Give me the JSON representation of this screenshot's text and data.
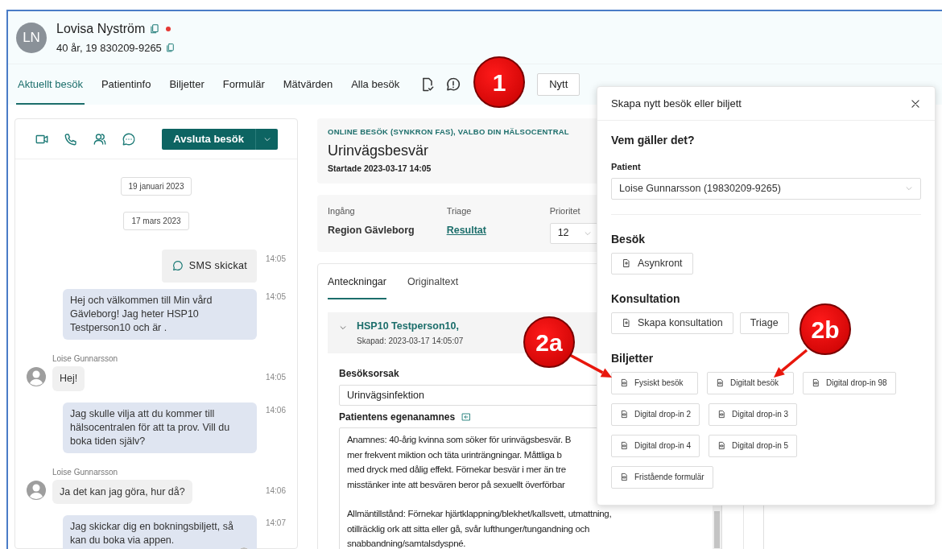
{
  "patient": {
    "initials": "LN",
    "name": "Lovisa Nyström",
    "alert": true,
    "details": "40 år, 19 830209-9265"
  },
  "tabs": [
    {
      "label": "Aktuellt besök",
      "selected": true
    },
    {
      "label": "Patientinfo",
      "selected": false
    },
    {
      "label": "Biljetter",
      "selected": false
    },
    {
      "label": "Formulär",
      "selected": false
    },
    {
      "label": "Mätvärden",
      "selected": false
    },
    {
      "label": "Alla besök",
      "selected": false
    }
  ],
  "new_button": "Nytt",
  "chat": {
    "end_button": "Avsluta besök",
    "items": [
      {
        "kind": "date",
        "text": "19 januari 2023"
      },
      {
        "kind": "date",
        "text": "17 mars 2023"
      },
      {
        "kind": "system",
        "text": "SMS skickat",
        "time": "14:05"
      },
      {
        "kind": "outgoing",
        "text": "Hej och välkommen till Min vård Gävleborg! Jag heter HSP10 Testperson10 och är .",
        "time": "14:05",
        "read": false
      },
      {
        "kind": "incoming",
        "sender": "Loise Gunnarsson",
        "text": "Hej!",
        "time": "14:05"
      },
      {
        "kind": "outgoing",
        "text": "Jag skulle vilja att du kommer till hälsocentralen för att ta prov. Vill du boka tiden själv?",
        "time": "14:06",
        "read": false
      },
      {
        "kind": "incoming",
        "sender": "Loise Gunnarsson",
        "text": "Ja det kan jag göra, hur då?",
        "time": "14:06"
      },
      {
        "kind": "outgoing",
        "text": "Jag skickar dig en bokningsbiljett, så kan du boka via appen.",
        "time": "14:07",
        "read": true
      }
    ]
  },
  "visit": {
    "context": "ONLINE BESÖK (SYNKRON FAS), VALBO DIN HÄLSOCENTRAL",
    "title": "Urinvägsbesvär",
    "started": "Startade 2023-03-17 14:05"
  },
  "info_fields": [
    {
      "kind": "text",
      "label": "Ingång",
      "value": "Region Gävleborg"
    },
    {
      "kind": "link",
      "label": "Triage",
      "value": "Resultat"
    },
    {
      "kind": "select",
      "label": "Prioritet",
      "value": "12"
    }
  ],
  "notes": {
    "tabs": [
      {
        "label": "Anteckningar",
        "selected": true
      },
      {
        "label": "Originaltext",
        "selected": false
      }
    ],
    "entry": {
      "expanded": true,
      "author": "HSP10 Testperson10,",
      "created": "Skapad: 2023-03-17 14:05:07",
      "reason_label": "Besöksorsak",
      "reason": "Urinvägsinfektion",
      "anamnesis_label": "Patientens egenanamnes",
      "paragraphs": [
        [
          "Anamnes: 40-årig kvinna som söker för urinvägsbesvär. B",
          "mer frekvent miktion och täta urinträngningar. Måttliga b",
          "med dryck med dålig effekt. Förnekar besvär i mer än tre",
          "misstänker inte att besvären beror på sexuellt överförbar"
        ],
        [
          "Allmäntillstånd: Förnekar hjärtklappning/blekhet/kallsvett, utmattning,",
          "otillräcklig ork att sitta eller gå, svår lufthunger/tungandning och",
          "snabbandning/samtalsdyspné."
        ]
      ]
    }
  },
  "popover": {
    "title": "Skapa nytt besök eller biljett",
    "who_heading": "Vem gäller det?",
    "patient_label": "Patient",
    "patient_value": "Loise Gunnarsson (19830209-9265)",
    "sections": [
      {
        "heading": "Besök",
        "rows": [
          [
            {
              "label": "Asynkront",
              "icon": true
            }
          ]
        ]
      },
      {
        "heading": "Konsultation",
        "rows": [
          [
            {
              "label": "Skapa konsultation",
              "icon": true
            },
            {
              "label": "Triage",
              "icon": false
            }
          ]
        ]
      },
      {
        "heading": "Biljetter",
        "small": true,
        "rows": [
          [
            {
              "label": "Fysiskt besök",
              "icon": true
            },
            {
              "label": "Digitalt besök",
              "icon": true
            },
            {
              "label": "Digital drop-in 98",
              "icon": true
            }
          ],
          [
            {
              "label": "Digital drop-in 2",
              "icon": true
            },
            {
              "label": "Digital drop-in 3",
              "icon": true
            }
          ],
          [
            {
              "label": "Digital drop-in 4",
              "icon": true
            },
            {
              "label": "Digital drop-in 5",
              "icon": true
            }
          ],
          [
            {
              "label": "Fristående formulär",
              "icon": true
            }
          ]
        ]
      }
    ]
  },
  "callouts": [
    {
      "label": "1",
      "arrow": false
    },
    {
      "label": "2a",
      "arrow": true
    },
    {
      "label": "2b",
      "arrow": true
    }
  ]
}
